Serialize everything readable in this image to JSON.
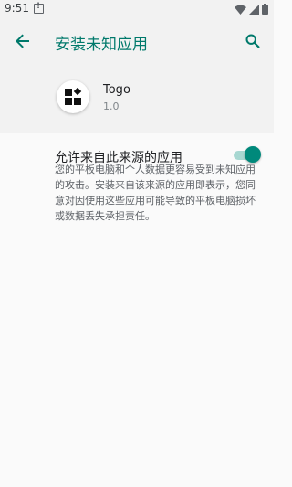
{
  "status_bar": {
    "time": "9:51"
  },
  "app_bar": {
    "title": "安装未知应用"
  },
  "app": {
    "name": "Togo",
    "version": "1.0"
  },
  "setting": {
    "label": "允许来自此来源的应用",
    "enabled": true
  },
  "warning": {
    "text": "您的平板电脑和个人数据更容易受到未知应用的攻击。安装来自该来源的应用即表示，您同意对因使用这些应用可能导致的平板电脑损坏或数据丢失承担责任。"
  },
  "colors": {
    "accent": "#00796b",
    "switch_thumb": "#00897b",
    "switch_track": "#a7d7d1"
  }
}
